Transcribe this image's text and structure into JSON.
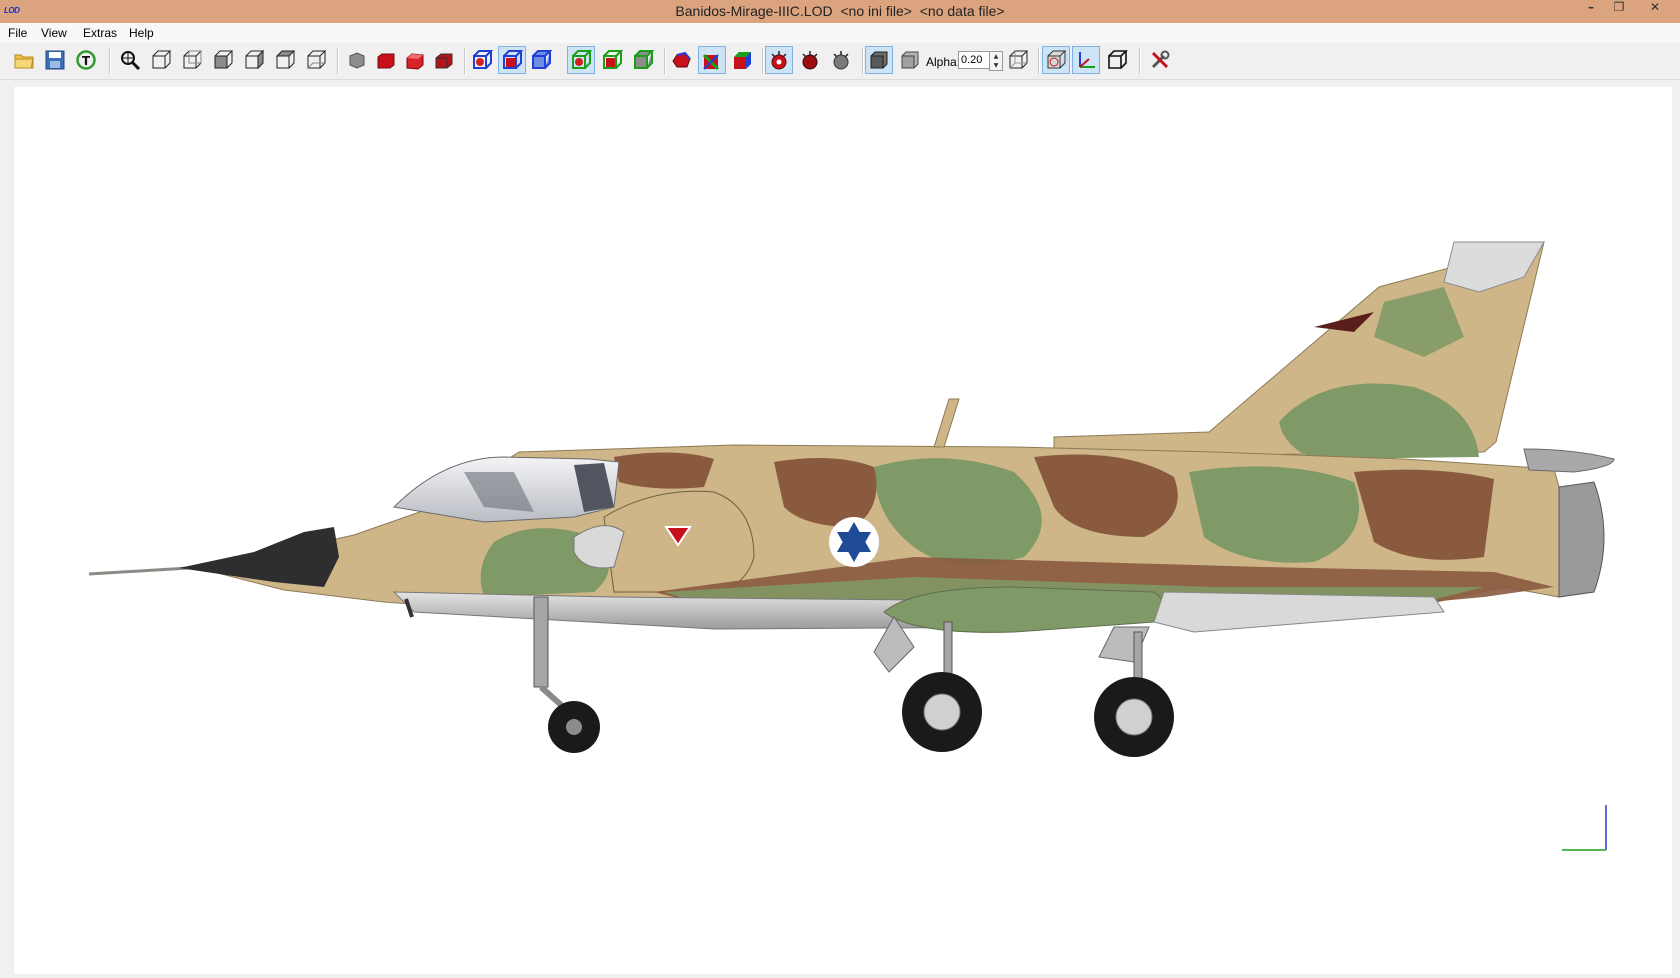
{
  "window": {
    "app_icon_text": "LOD",
    "title": "Banidos-Mirage-IIIC.LOD  <no ini file>  <no data file>",
    "minimize_glyph": "–",
    "restore_glyph": "❐",
    "close_glyph": "✕"
  },
  "menu": {
    "items": [
      "File",
      "View",
      "Extras",
      "Help"
    ]
  },
  "toolbar": {
    "alpha_label": "Alpha:",
    "alpha_value": "0.20",
    "spin_up": "▲",
    "spin_down": "▼",
    "icons": [
      "open-folder-icon",
      "save-icon",
      "reload-icon",
      "zoom-fit-icon",
      "view-front-icon",
      "view-back-icon",
      "view-left-icon",
      "view-right-icon",
      "view-top-icon",
      "view-bottom-icon",
      "gray-shape-icon",
      "red-solid-icon",
      "red-shaded-icon",
      "red-textured-icon",
      "blue-wireframe-icon",
      "blue-solid-icon",
      "blue-shaded-icon",
      "green-wireframe-icon",
      "green-solid-icon",
      "green-shaded-icon",
      "colored-shape-icon",
      "normals-icon",
      "rgb-cube-icon",
      "bomb-icon",
      "bomb-dark-icon",
      "bomb-gray-icon",
      "gray-box-icon",
      "transparent-box-icon",
      "transparency-box-icon",
      "grid-icon",
      "axes-icon",
      "cube-outline-icon",
      "settings-tools-icon"
    ],
    "colors": {
      "red": "#c8101a",
      "blue": "#1f3fd8",
      "green": "#19a019",
      "highlight": "#cde4f7"
    }
  },
  "viewport": {
    "model": "Mirage IIIC aircraft side view",
    "colors": {
      "sand": "#cfb689",
      "olive": "#7f9a66",
      "brown": "#8a5a3f",
      "roundel": "#1f4b96"
    }
  }
}
